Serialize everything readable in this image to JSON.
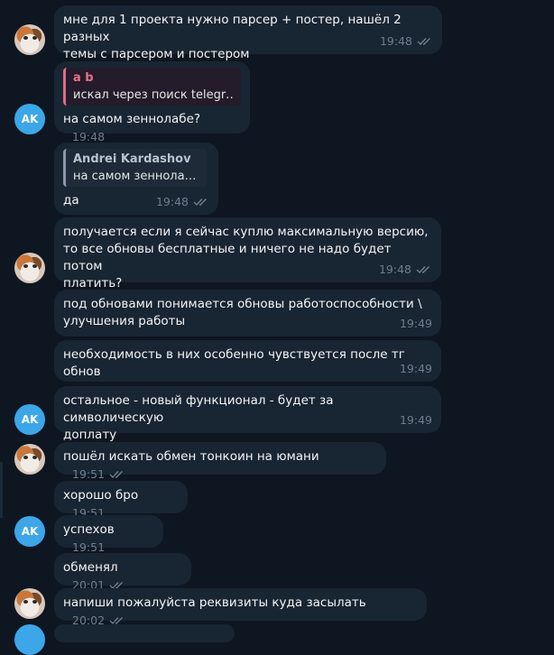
{
  "messages": [
    {
      "text": "мне для 1 проекта нужно парсер + постер, нашёл 2 разных\nтемы с парсером и постером",
      "time": "19:48"
    },
    {
      "reply_name": "a b",
      "reply_text": "искал через поиск telegr…",
      "text": "на самом зеннолабе?",
      "time": "19:48"
    },
    {
      "reply_name": "Andrei Kardashov",
      "reply_text": "на самом зеннола…",
      "text": "да",
      "time": "19:48"
    },
    {
      "text": "получается если я сейчас куплю максимальную версию,\nто все обновы бесплатные и ничего не надо будет потом\nплатить?",
      "time": "19:48"
    },
    {
      "text": "под обновами понимается обновы работоспособности \\\nулучшения работы",
      "time": "19:49"
    },
    {
      "text": "необходимость в них особенно чувствуется после тг обнов",
      "time": "19:49"
    },
    {
      "text": "остальное - новый функционал - будет за символическую\nдоплату",
      "time": "19:49"
    },
    {
      "text": "пошёл искать обмен тонкоин на юмани",
      "time": "19:51"
    },
    {
      "text": "хорошо бро",
      "time": "19:51"
    },
    {
      "text": "успехов",
      "time": "19:51"
    },
    {
      "text": "обменял",
      "time": "20:01"
    },
    {
      "text": "напиши пожалуйста реквизиты куда засылать",
      "time": "20:02"
    }
  ],
  "avatars": {
    "ak_initials": "AK"
  },
  "colors": {
    "background": "#0e1621",
    "bubble": "#182533",
    "meta": "#6d7f8f",
    "avatar_ak": "#3ca6e8",
    "reply_accent": "#e06c85"
  }
}
